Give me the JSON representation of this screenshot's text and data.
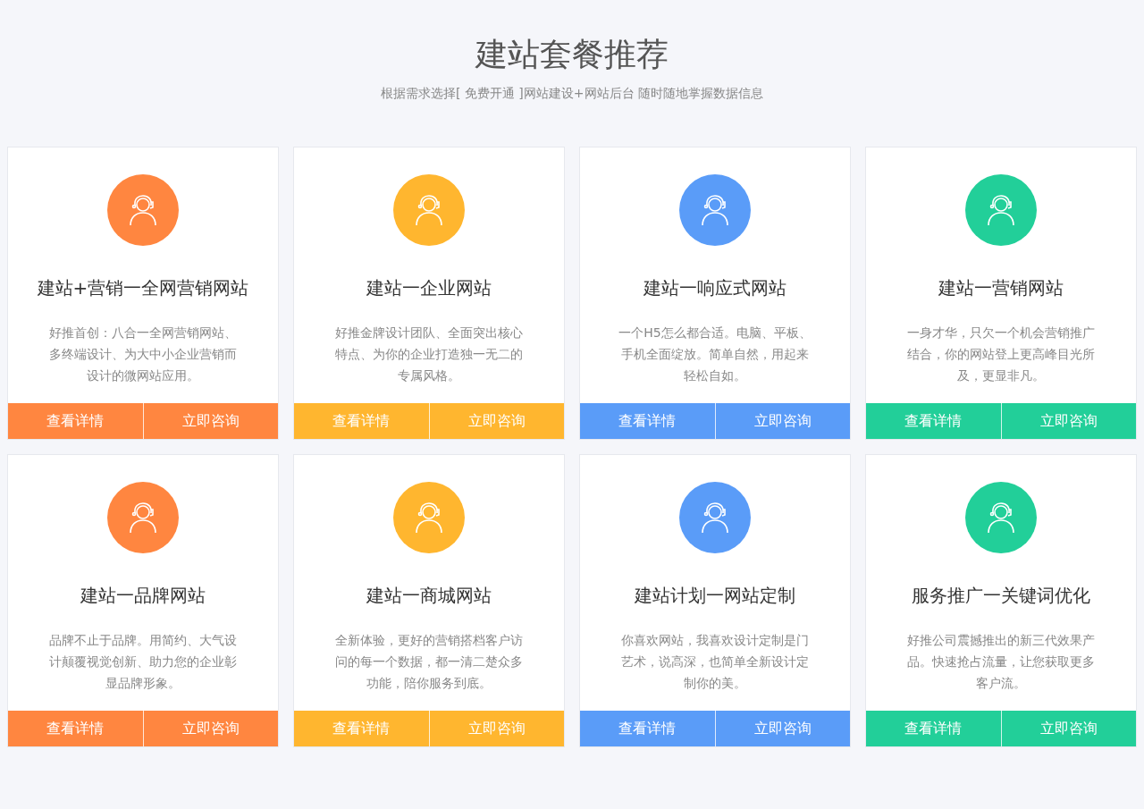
{
  "header": {
    "title": "建站套餐推荐",
    "subtitle": "根据需求选择[ 免费开通 ]网站建设+网站后台 随时随地掌握数据信息"
  },
  "packages": [
    {
      "title": "建站+营销一全网营销网站",
      "description": "好推首创：八合一全网营销网站、多终端设计、为大中小企业营销而设计的微网站应用。",
      "color": "#ff8640",
      "buttons": [
        "查看详情",
        "立即咨询"
      ]
    },
    {
      "title": "建站一企业网站",
      "description": "好推金牌设计团队、全面突出核心特点、为你的企业打造独一无二的专属风格。",
      "color": "#ffb62f",
      "buttons": [
        "查看详情",
        "立即咨询"
      ]
    },
    {
      "title": "建站一响应式网站",
      "description": "一个H5怎么都合适。电脑、平板、手机全面绽放。简单自然，用起来轻松自如。",
      "color": "#5a9cf8",
      "buttons": [
        "查看详情",
        "立即咨询"
      ]
    },
    {
      "title": "建站一营销网站",
      "description": "一身才华，只欠一个机会营销推广结合，你的网站登上更高峰目光所及，更显非凡。",
      "color": "#22cf99",
      "buttons": [
        "查看详情",
        "立即咨询"
      ]
    },
    {
      "title": "建站一品牌网站",
      "description": "品牌不止于品牌。用简约、大气设计颠覆视觉创新、助力您的企业彰显品牌形象。",
      "color": "#ff8640",
      "buttons": [
        "查看详情",
        "立即咨询"
      ]
    },
    {
      "title": "建站一商城网站",
      "description": "全新体验，更好的营销搭档客户访问的每一个数据，都一清二楚众多功能，陪你服务到底。",
      "color": "#ffb62f",
      "buttons": [
        "查看详情",
        "立即咨询"
      ]
    },
    {
      "title": "建站计划一网站定制",
      "description": "你喜欢网站，我喜欢设计定制是门艺术，说高深，也简单全新设计定制你的美。",
      "color": "#5a9cf8",
      "buttons": [
        "查看详情",
        "立即咨询"
      ]
    },
    {
      "title": "服务推广一关键词优化",
      "description": "好推公司震撼推出的新三代效果产品。快速抢占流量，让您获取更多客户流。",
      "color": "#22cf99",
      "buttons": [
        "查看详情",
        "立即咨询"
      ]
    }
  ]
}
